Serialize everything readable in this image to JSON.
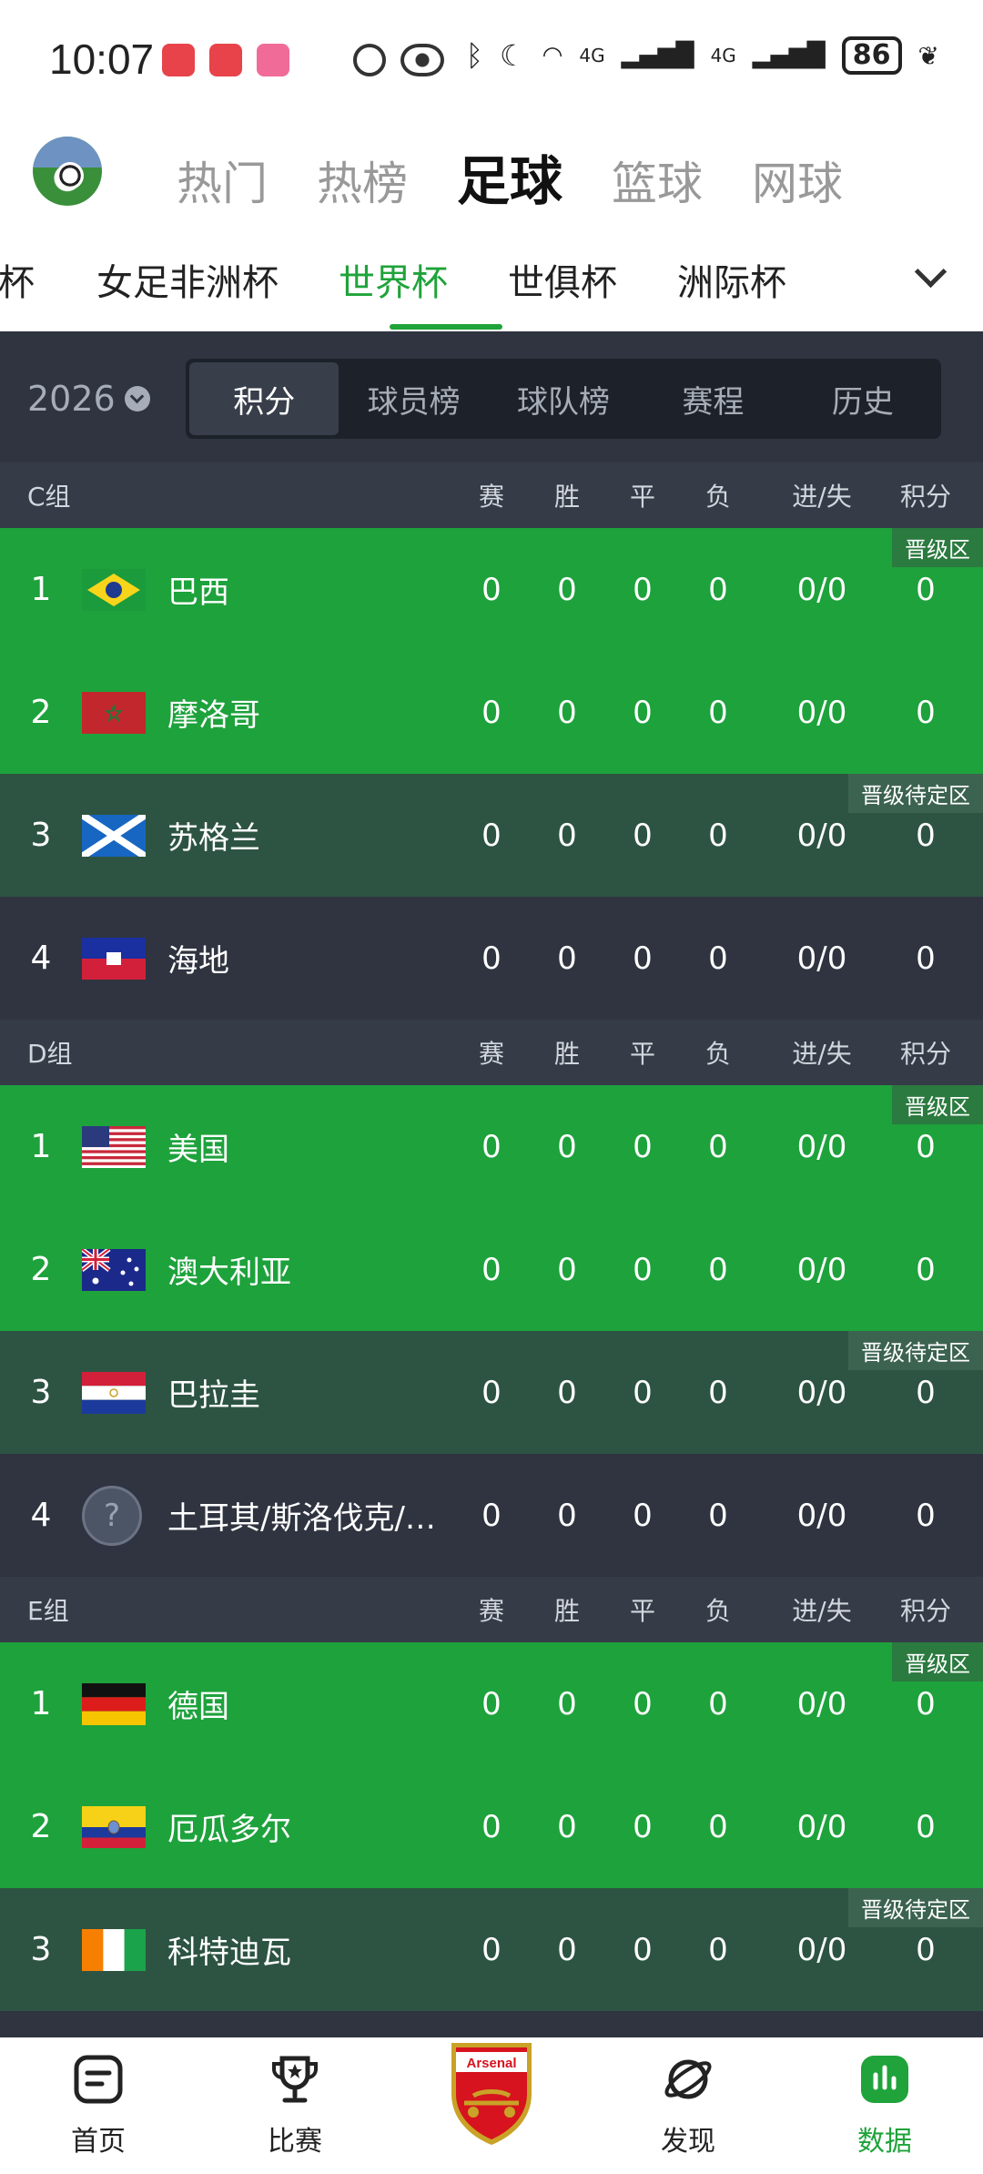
{
  "status_bar": {
    "time": "10:07",
    "battery": "86",
    "network": [
      "4G",
      "4G"
    ]
  },
  "sport_tabs": [
    {
      "label": "热门",
      "active": false
    },
    {
      "label": "热榜",
      "active": false
    },
    {
      "label": "足球",
      "active": true
    },
    {
      "label": "篮球",
      "active": false
    },
    {
      "label": "网球",
      "active": false
    }
  ],
  "league_tabs": [
    {
      "label": "洲杯",
      "active": false
    },
    {
      "label": "女足非洲杯",
      "active": false
    },
    {
      "label": "世界杯",
      "active": true
    },
    {
      "label": "世俱杯",
      "active": false
    },
    {
      "label": "洲际杯",
      "active": false
    }
  ],
  "filter": {
    "year": "2026",
    "segments": [
      {
        "label": "积分",
        "active": true
      },
      {
        "label": "球员榜",
        "active": false
      },
      {
        "label": "球队榜",
        "active": false
      },
      {
        "label": "赛程",
        "active": false
      },
      {
        "label": "历史",
        "active": false
      }
    ]
  },
  "columns": [
    "赛",
    "胜",
    "平",
    "负",
    "进/失",
    "积分"
  ],
  "groups": [
    {
      "name": "C组",
      "rows": [
        {
          "rank": "1",
          "team": "巴西",
          "flag": "brazil",
          "style": "green",
          "zone": "晋级区",
          "p": "0",
          "w": "0",
          "d": "0",
          "l": "0",
          "gf": "0/0",
          "pts": "0"
        },
        {
          "rank": "2",
          "team": "摩洛哥",
          "flag": "morocco",
          "style": "green",
          "zone": "",
          "p": "0",
          "w": "0",
          "d": "0",
          "l": "0",
          "gf": "0/0",
          "pts": "0"
        },
        {
          "rank": "3",
          "team": "苏格兰",
          "flag": "scotland",
          "style": "darkgreen",
          "zone": "晋级待定区",
          "p": "0",
          "w": "0",
          "d": "0",
          "l": "0",
          "gf": "0/0",
          "pts": "0"
        },
        {
          "rank": "4",
          "team": "海地",
          "flag": "haiti",
          "style": "dark",
          "zone": "",
          "p": "0",
          "w": "0",
          "d": "0",
          "l": "0",
          "gf": "0/0",
          "pts": "0"
        }
      ]
    },
    {
      "name": "D组",
      "rows": [
        {
          "rank": "1",
          "team": "美国",
          "flag": "usa",
          "style": "green",
          "zone": "晋级区",
          "p": "0",
          "w": "0",
          "d": "0",
          "l": "0",
          "gf": "0/0",
          "pts": "0"
        },
        {
          "rank": "2",
          "team": "澳大利亚",
          "flag": "australia",
          "style": "green",
          "zone": "",
          "p": "0",
          "w": "0",
          "d": "0",
          "l": "0",
          "gf": "0/0",
          "pts": "0"
        },
        {
          "rank": "3",
          "team": "巴拉圭",
          "flag": "paraguay",
          "style": "darkgreen",
          "zone": "晋级待定区",
          "p": "0",
          "w": "0",
          "d": "0",
          "l": "0",
          "gf": "0/0",
          "pts": "0"
        },
        {
          "rank": "4",
          "team": "土耳其/斯洛伐克/…",
          "flag": "unknown",
          "style": "dark",
          "zone": "",
          "p": "0",
          "w": "0",
          "d": "0",
          "l": "0",
          "gf": "0/0",
          "pts": "0"
        }
      ]
    },
    {
      "name": "E组",
      "rows": [
        {
          "rank": "1",
          "team": "德国",
          "flag": "germany",
          "style": "green",
          "zone": "晋级区",
          "p": "0",
          "w": "0",
          "d": "0",
          "l": "0",
          "gf": "0/0",
          "pts": "0"
        },
        {
          "rank": "2",
          "team": "厄瓜多尔",
          "flag": "ecuador",
          "style": "green",
          "zone": "",
          "p": "0",
          "w": "0",
          "d": "0",
          "l": "0",
          "gf": "0/0",
          "pts": "0"
        },
        {
          "rank": "3",
          "team": "科特迪瓦",
          "flag": "ivorycoast",
          "style": "darkgreen",
          "zone": "晋级待定区",
          "p": "0",
          "w": "0",
          "d": "0",
          "l": "0",
          "gf": "0/0",
          "pts": "0"
        }
      ]
    }
  ],
  "bottom_nav": [
    {
      "label": "首页",
      "icon": "home-icon",
      "active": false
    },
    {
      "label": "比赛",
      "icon": "trophy-icon",
      "active": false
    },
    {
      "label": "",
      "icon": "arsenal-crest-icon",
      "active": false,
      "crest_text": "Arsenal"
    },
    {
      "label": "发现",
      "icon": "planet-icon",
      "active": false
    },
    {
      "label": "数据",
      "icon": "chart-icon",
      "active": true
    }
  ],
  "colors": {
    "accent": "#1fa33a",
    "qualify_row": "#1ea23c",
    "pending_row": "#2d5442",
    "dark_row": "#2f3440",
    "header_row": "#353b47"
  }
}
